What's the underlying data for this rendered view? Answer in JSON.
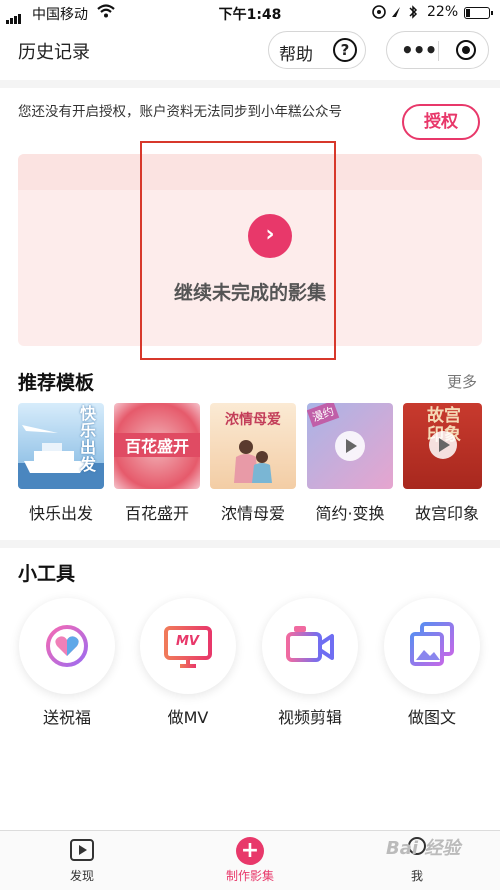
{
  "status_bar": {
    "carrier": "中国移动",
    "time": "下午1:48",
    "battery_pct": "22%",
    "battery_level": 0.22
  },
  "header": {
    "title": "历史记录",
    "help_label": "帮助",
    "help_glyph": "?",
    "menu_glyph": "•••"
  },
  "auth": {
    "notice": "您还没有开启授权，账户资料无法同步到小年糕公众号",
    "button": "授权"
  },
  "banner": {
    "icon": "chevron-right-icon",
    "glyph": "›",
    "text": "继续未完成的影集"
  },
  "templates": {
    "title": "推荐模板",
    "more": "更多",
    "items": [
      {
        "label": "快乐出发",
        "art": "快乐出发",
        "colors": [
          "#cfe6f7",
          "#6fa9d9"
        ]
      },
      {
        "label": "百花盛开",
        "art": "百花盛开",
        "colors": [
          "#f7c9c9",
          "#e45a6a"
        ]
      },
      {
        "label": "浓情母爱",
        "art": "浓情母爱",
        "colors": [
          "#f6e2c8",
          "#c8586b"
        ]
      },
      {
        "label": "简约·变换",
        "art": "漫约",
        "colors": [
          "#b7bde8",
          "#e89ac6"
        ]
      },
      {
        "label": "故宫印象",
        "art": "故宫印象",
        "colors": [
          "#c6372c",
          "#f4d9b8"
        ]
      }
    ]
  },
  "tools": {
    "title": "小工具",
    "items": [
      {
        "label": "送祝福",
        "icon": "heart-bubble-icon"
      },
      {
        "label": "做MV",
        "icon": "mv-monitor-icon",
        "icon_text": "MV"
      },
      {
        "label": "视频剪辑",
        "icon": "video-camera-icon"
      },
      {
        "label": "做图文",
        "icon": "image-gallery-icon"
      }
    ]
  },
  "tabbar": {
    "items": [
      {
        "label": "发现",
        "icon": "play-icon"
      },
      {
        "label": "制作影集",
        "icon": "plus-icon",
        "glyph": "+"
      },
      {
        "label": "我",
        "icon": "person-icon"
      }
    ],
    "accent": "#e8386a"
  },
  "watermark": "Bai 经验"
}
